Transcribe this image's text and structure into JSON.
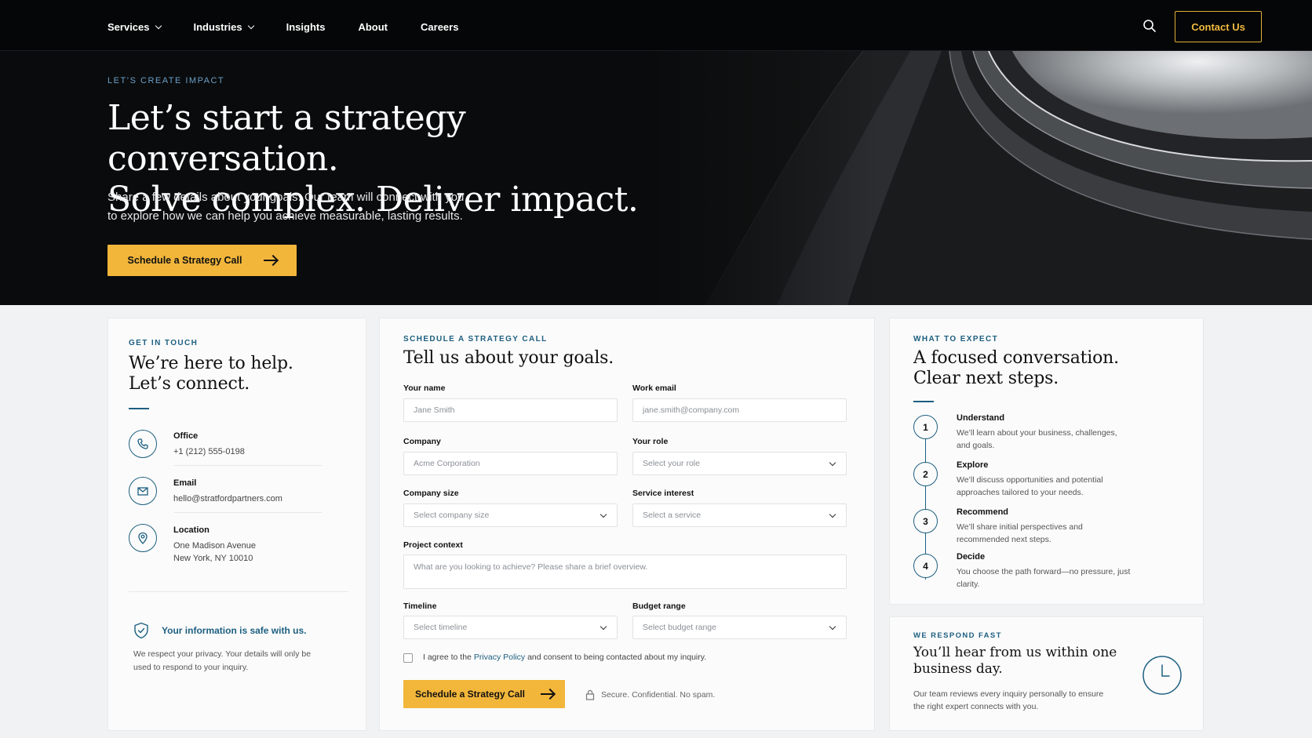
{
  "nav": {
    "items": [
      {
        "label": "Services",
        "dropdown": true
      },
      {
        "label": "Industries",
        "dropdown": true
      },
      {
        "label": "Insights",
        "dropdown": false
      },
      {
        "label": "About",
        "dropdown": false
      },
      {
        "label": "Careers",
        "dropdown": false
      }
    ],
    "search_icon": "search-icon",
    "cta_label": "Contact Us"
  },
  "hero": {
    "eyebrow": "LET’S CREATE IMPACT",
    "title_line1": "Let’s start a strategy conversation.",
    "title_line2": "Solve complex. Deliver impact.",
    "subtitle_line1": "Share a few details about your goals. Our team will connect with you",
    "subtitle_line2": "to explore how we can help you achieve measurable, lasting results.",
    "cta_label": "Schedule a Strategy Call"
  },
  "contact_card": {
    "eyebrow": "GET IN TOUCH",
    "title_line1": "We’re here to help.",
    "title_line2": "Let’s connect.",
    "items": [
      {
        "icon": "phone-icon",
        "label": "Office",
        "value": "+1 (212) 555-0198",
        "value2": ""
      },
      {
        "icon": "mail-icon",
        "label": "Email",
        "value": "hello@stratfordpartners.com",
        "value2": ""
      },
      {
        "icon": "location-pin-icon",
        "label": "Location",
        "value": "One Madison Avenue",
        "value2": "New York, NY 10010"
      }
    ],
    "privacy_title": "Your information is safe with us.",
    "privacy_line1": "We respect your privacy. Your details will only be",
    "privacy_line2": "used to respond to your inquiry."
  },
  "form": {
    "eyebrow": "SCHEDULE A STRATEGY CALL",
    "title": "Tell us about your goals.",
    "name_label": "Your name",
    "name_placeholder": "Jane Smith",
    "email_label": "Work email",
    "email_placeholder": "jane.smith@company.com",
    "company_label": "Company",
    "company_placeholder": "Acme Corporation",
    "role_label": "Your role",
    "role_value": "Select your role",
    "size_label": "Company size",
    "size_value": "Select company size",
    "service_label": "Service interest",
    "service_value": "Select a service",
    "context_label": "Project context",
    "context_placeholder": "What are you looking to achieve? Please share a brief overview.",
    "timeline_label": "Timeline",
    "timeline_value": "Select timeline",
    "budget_label": "Budget range",
    "budget_value": "Select budget range",
    "consent_prefix": "I agree to the",
    "consent_link": "Privacy Policy",
    "consent_suffix": "and consent to being contacted about my inquiry.",
    "submit_label": "Schedule a Strategy Call",
    "secure_note": "Secure. Confidential. No spam."
  },
  "expect_card": {
    "eyebrow": "WHAT TO EXPECT",
    "title_line1": "A focused conversation.",
    "title_line2": "Clear next steps.",
    "steps": [
      {
        "num": "1",
        "title": "Understand",
        "desc": "We’ll learn about your business, challenges, and goals."
      },
      {
        "num": "2",
        "title": "Explore",
        "desc": "We’ll discuss opportunities and potential approaches tailored to your needs."
      },
      {
        "num": "3",
        "title": "Recommend",
        "desc": "We’ll share initial perspectives and recommended next steps."
      },
      {
        "num": "4",
        "title": "Decide",
        "desc": "You choose the path forward—no pressure, just clarity."
      }
    ]
  },
  "respond_card": {
    "eyebrow": "WE RESPOND FAST",
    "title_line1": "You’ll hear from us within one",
    "title_line2": "business day.",
    "desc_line1": "Our team reviews every inquiry personally to ensure",
    "desc_line2": "the right expert connects with you.",
    "icon": "clock-icon"
  },
  "colors": {
    "accent_gold": "#f2b63b",
    "accent_blue": "#1d5f80",
    "nav_bg": "#050607"
  }
}
